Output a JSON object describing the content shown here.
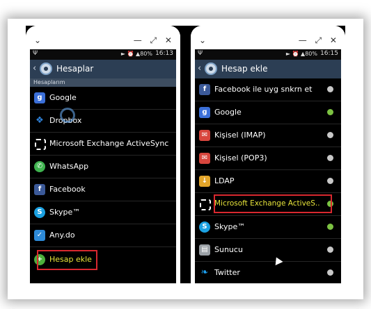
{
  "left": {
    "time": "16:13",
    "battery": "80%",
    "title": "Hesaplar",
    "section": "Hesaplarım",
    "items": [
      {
        "label": "Google",
        "icon": "google-icon"
      },
      {
        "label": "Dropbox",
        "icon": "dropbox-icon"
      },
      {
        "label": "Microsoft Exchange ActiveSync",
        "icon": "exchange-icon"
      },
      {
        "label": "WhatsApp",
        "icon": "whatsapp-icon"
      },
      {
        "label": "Facebook",
        "icon": "facebook-icon"
      },
      {
        "label": "Skype™",
        "icon": "skype-icon"
      },
      {
        "label": "Any.do",
        "icon": "anydo-icon"
      }
    ],
    "add_label": "Hesap ekle"
  },
  "right": {
    "time": "16:15",
    "battery": "80%",
    "title": "Hesap ekle",
    "items": [
      {
        "label": "Facebook ile uyg snkrn et",
        "icon": "facebook-icon",
        "synced": false
      },
      {
        "label": "Google",
        "icon": "google-icon",
        "synced": true
      },
      {
        "label": "Kişisel (IMAP)",
        "icon": "mail-icon",
        "synced": false
      },
      {
        "label": "Kişisel (POP3)",
        "icon": "mail-icon",
        "synced": false
      },
      {
        "label": "LDAP",
        "icon": "ldap-icon",
        "synced": false
      },
      {
        "label": "Microsoft Exchange ActiveS..",
        "icon": "exchange-icon",
        "synced": true
      },
      {
        "label": "Skype™",
        "icon": "skype-icon",
        "synced": true
      },
      {
        "label": "Sunucu",
        "icon": "server-icon",
        "synced": false
      },
      {
        "label": "Twitter",
        "icon": "twitter-icon",
        "synced": false
      }
    ]
  },
  "colors": {
    "actionbar": "#2c3e54",
    "highlight": "#d9282f",
    "selected_text": "#e8e53a",
    "sync_on": "#7cc242",
    "sync_off": "#c8c8c8"
  }
}
